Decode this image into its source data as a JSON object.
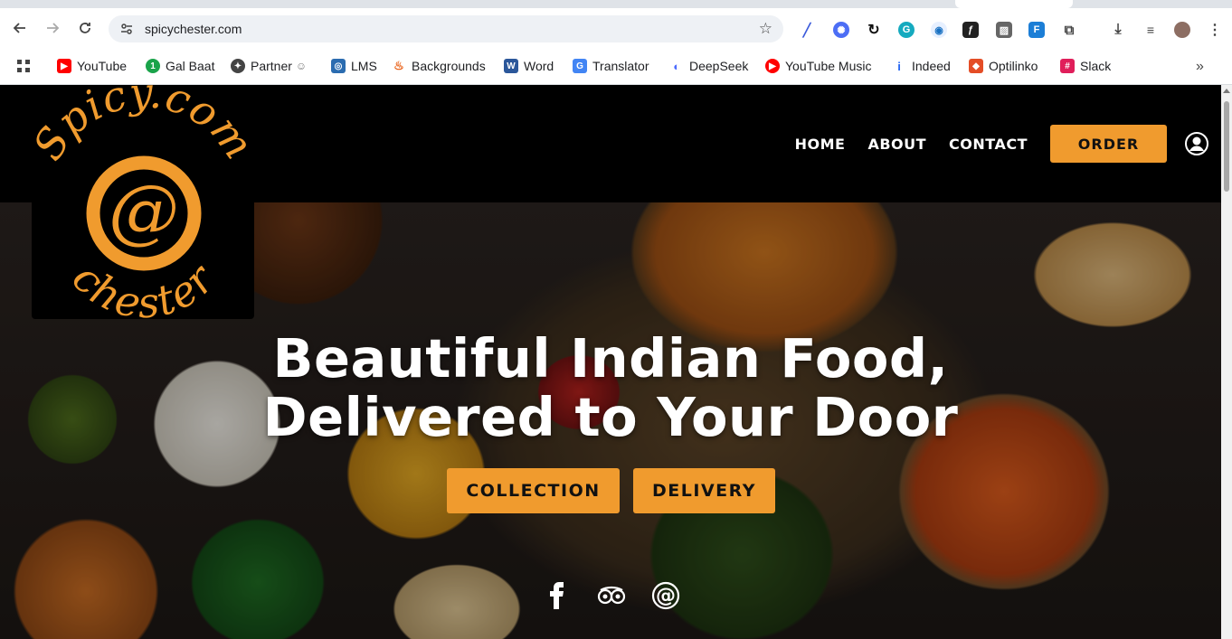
{
  "browser": {
    "url": "spicychester.com",
    "bookmarks": [
      {
        "label": "YouTube",
        "icon": "youtube-icon",
        "color": "#ff0000"
      },
      {
        "label": "Gal Baat",
        "icon": "galbaat-icon",
        "color": "#1aa34a"
      },
      {
        "label": "Partner",
        "icon": "partner-icon",
        "color": "#444444"
      },
      {
        "label": "LMS",
        "icon": "lms-icon",
        "color": "#2b6cb0"
      },
      {
        "label": "Backgrounds",
        "icon": "backgrounds-icon",
        "color": "#e8590c"
      },
      {
        "label": "Word",
        "icon": "word-icon",
        "color": "#2b579a"
      },
      {
        "label": "Translator",
        "icon": "translator-icon",
        "color": "#4285f4"
      },
      {
        "label": "DeepSeek",
        "icon": "deepseek-icon",
        "color": "#4d6bfe"
      },
      {
        "label": "YouTube Music",
        "icon": "youtube-music-icon",
        "color": "#ff0000"
      },
      {
        "label": "Indeed",
        "icon": "indeed-icon",
        "color": "#2164f3"
      },
      {
        "label": "Optilinko",
        "icon": "optilinko-icon",
        "color": "#e44d26"
      },
      {
        "label": "Slack",
        "icon": "slack-icon",
        "color": "#e01e5a"
      }
    ]
  },
  "site": {
    "logo": {
      "top_text": "Spicy.com",
      "symbol": "@",
      "bottom_text": "chester",
      "color": "#f09b2e"
    },
    "nav": {
      "home": "HOME",
      "about": "ABOUT",
      "contact": "CONTACT",
      "order": "ORDER"
    },
    "hero": {
      "headline_line1": "Beautiful Indian Food,",
      "headline_line2": "Delivered to Your Door",
      "collection_label": "COLLECTION",
      "delivery_label": "DELIVERY"
    },
    "social": [
      "facebook-icon",
      "tripadvisor-icon",
      "at-sign-icon"
    ],
    "accent_color": "#f09b2e"
  }
}
